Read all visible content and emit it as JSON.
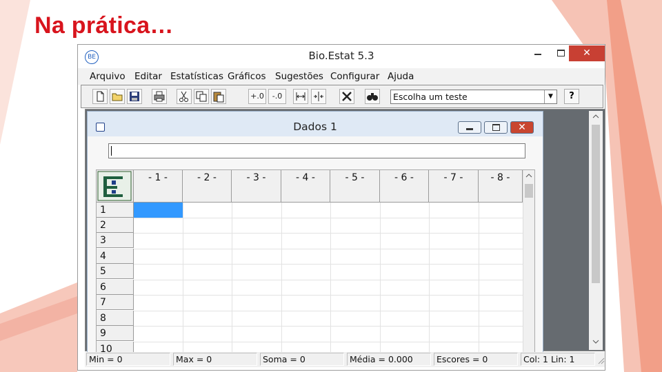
{
  "slide": {
    "title": "Na prática…"
  },
  "window": {
    "title": "Bio.Estat 5.3",
    "icon_text": "BE",
    "close_glyph": "✕"
  },
  "menu": [
    "Arquivo",
    "Editar",
    "Estatísticas",
    "Gráficos",
    "Sugestões",
    "Configurar",
    "Ajuda"
  ],
  "toolbar": {
    "decimal_plus": "+.0",
    "decimal_minus": "-.0",
    "test_select": "Escolha um teste",
    "help_label": "?"
  },
  "sheet": {
    "title": "Dados 1",
    "formula_value": "",
    "columns": [
      "- 1 -",
      "- 2 -",
      "- 3 -",
      "- 4 -",
      "- 5 -",
      "- 6 -",
      "- 7 -",
      "- 8 -"
    ],
    "rows": [
      "1",
      "2",
      "3",
      "4",
      "5",
      "6",
      "7",
      "8",
      "9",
      "10"
    ],
    "selected_cell": {
      "row": 1,
      "col": 1
    }
  },
  "status": {
    "min": "Min = 0",
    "max": "Max = 0",
    "sum": "Soma = 0",
    "mean": "Média = 0.000",
    "scores": "Escores = 0",
    "position": "Col: 1  Lin: 1"
  },
  "colors": {
    "title_red": "#d8141d",
    "selection_blue": "#3399ff",
    "close_red": "#c84033",
    "deco_salmon": "#f1a290"
  }
}
